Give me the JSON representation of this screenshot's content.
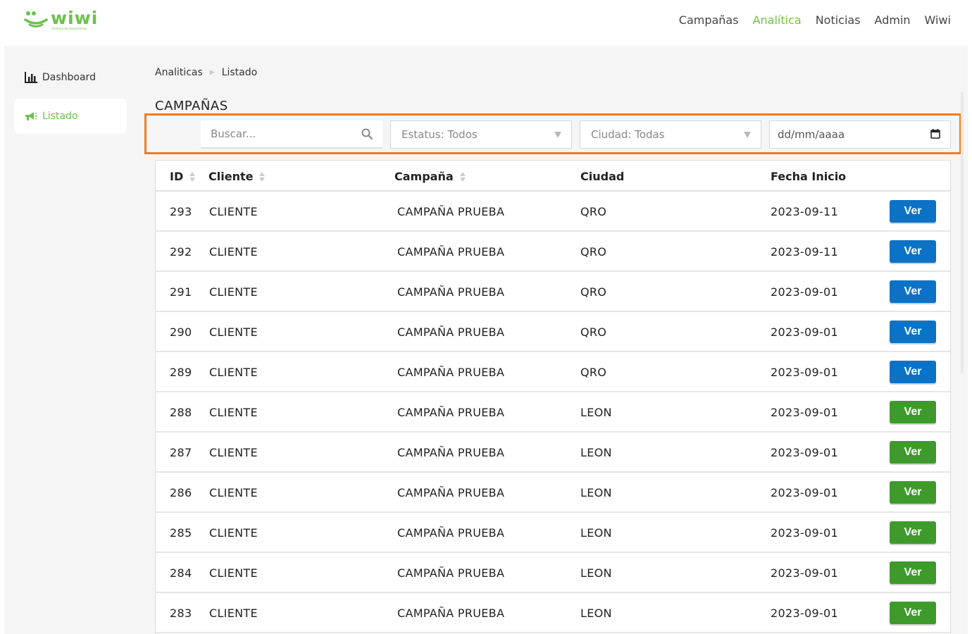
{
  "brand": {
    "name": "wiwi",
    "tagline": "Sistema de experiencias",
    "color": "#6cc24a"
  },
  "nav": [
    {
      "label": "Campañas",
      "active": false
    },
    {
      "label": "Analítica",
      "active": true
    },
    {
      "label": "Noticias",
      "active": false
    },
    {
      "label": "Admin",
      "active": false
    },
    {
      "label": "Wiwi",
      "active": false
    }
  ],
  "sidebar": {
    "items": [
      {
        "label": "Dashboard",
        "icon": "bar-chart-icon",
        "active": false
      },
      {
        "label": "Listado",
        "icon": "megaphone-icon",
        "active": true
      }
    ]
  },
  "breadcrumb": {
    "items": [
      "Analiticas",
      "Listado"
    ]
  },
  "page": {
    "title": "CAMPAÑAS"
  },
  "filters": {
    "search_placeholder": "Buscar...",
    "status_label": "Estatus: Todos",
    "city_label": "Ciudad: Todas",
    "date_placeholder": "dd/mm/aaaa"
  },
  "table": {
    "columns": [
      "ID",
      "Cliente",
      "Campaña",
      "Ciudad",
      "Fecha Inicio"
    ],
    "button_label": "Ver",
    "colors": {
      "blue": "#0b72c6",
      "green": "#3f9a2c"
    },
    "rows": [
      {
        "id": "293",
        "cliente": "CLIENTE",
        "campana": "CAMPAÑA PRUEBA",
        "ciudad": "QRO",
        "fecha": "2023-09-11",
        "btn": "blue"
      },
      {
        "id": "292",
        "cliente": "CLIENTE",
        "campana": "CAMPAÑA PRUEBA",
        "ciudad": "QRO",
        "fecha": "2023-09-11",
        "btn": "blue"
      },
      {
        "id": "291",
        "cliente": "CLIENTE",
        "campana": "CAMPAÑA PRUEBA",
        "ciudad": "QRO",
        "fecha": "2023-09-01",
        "btn": "blue"
      },
      {
        "id": "290",
        "cliente": "CLIENTE",
        "campana": "CAMPAÑA PRUEBA",
        "ciudad": "QRO",
        "fecha": "2023-09-01",
        "btn": "blue"
      },
      {
        "id": "289",
        "cliente": "CLIENTE",
        "campana": "CAMPAÑA PRUEBA",
        "ciudad": "QRO",
        "fecha": "2023-09-01",
        "btn": "blue"
      },
      {
        "id": "288",
        "cliente": "CLIENTE",
        "campana": "CAMPAÑA PRUEBA",
        "ciudad": "LEON",
        "fecha": "2023-09-01",
        "btn": "green"
      },
      {
        "id": "287",
        "cliente": "CLIENTE",
        "campana": "CAMPAÑA PRUEBA",
        "ciudad": "LEON",
        "fecha": "2023-09-01",
        "btn": "green"
      },
      {
        "id": "286",
        "cliente": "CLIENTE",
        "campana": "CAMPAÑA PRUEBA",
        "ciudad": "LEON",
        "fecha": "2023-09-01",
        "btn": "green"
      },
      {
        "id": "285",
        "cliente": "CLIENTE",
        "campana": "CAMPAÑA PRUEBA",
        "ciudad": "LEON",
        "fecha": "2023-09-01",
        "btn": "green"
      },
      {
        "id": "284",
        "cliente": "CLIENTE",
        "campana": "CAMPAÑA PRUEBA",
        "ciudad": "LEON",
        "fecha": "2023-09-01",
        "btn": "green"
      },
      {
        "id": "283",
        "cliente": "CLIENTE",
        "campana": "CAMPAÑA PRUEBA",
        "ciudad": "LEON",
        "fecha": "2023-09-01",
        "btn": "green"
      }
    ]
  }
}
